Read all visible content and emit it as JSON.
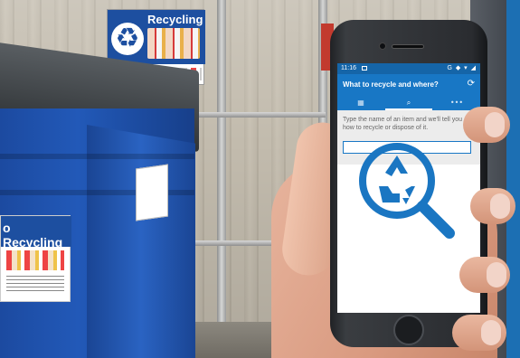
{
  "scene": {
    "fence_sign_title": "Recycling",
    "bin_label_title": "o Recycling"
  },
  "phone": {
    "status": {
      "time": "11:16",
      "right_icons": "G ◆ ▾ ◢"
    },
    "app_bar": {
      "title": "What to recycle and where?",
      "refresh_icon": "refresh-icon"
    },
    "tabs": [
      {
        "icon": "calendar-icon",
        "glyph": "▦",
        "active": false
      },
      {
        "icon": "search-icon",
        "glyph": "⌕",
        "active": true
      },
      {
        "icon": "more-icon",
        "glyph": "•••",
        "active": false
      }
    ],
    "helper_text": "Type the name of an item and we'll tell you how to recycle or dispose of it.",
    "search": {
      "value": "",
      "placeholder": ""
    },
    "illustration": "recycle-search-icon"
  },
  "colors": {
    "app_blue": "#1877c5",
    "status_blue": "#1565a8",
    "icon_blue": "#1a76c2"
  }
}
